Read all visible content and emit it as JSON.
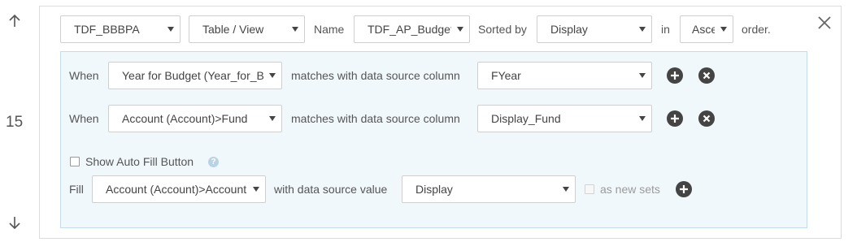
{
  "row": {
    "number": "15"
  },
  "icons": {
    "move_up": "arrow-up-icon",
    "move_down": "arrow-down-icon",
    "close": "close-icon",
    "add": "plus-circle-icon",
    "remove": "x-circle-icon",
    "help": "question-circle-icon"
  },
  "header": {
    "source_select": "TDF_BBBPA",
    "type_select": "Table / View",
    "name_label": "Name",
    "name_select": "TDF_AP_Budget...",
    "sorted_by_label": "Sorted by",
    "sort_field_select": "Display",
    "in_label": "in",
    "order_select": "Ascending",
    "order_label": "order."
  },
  "conditions": [
    {
      "when_label": "When",
      "field_select": "Year for Budget (Year_for_Budget)",
      "matches_label": "matches with data source column",
      "column_select": "FYear"
    },
    {
      "when_label": "When",
      "field_select": "Account (Account)>Fund",
      "matches_label": "matches with data source column",
      "column_select": "Display_Fund"
    }
  ],
  "auto_fill": {
    "label": "Show Auto Fill Button",
    "checked": false
  },
  "fill": {
    "fill_label": "Fill",
    "field_select": "Account (Account)>Account",
    "with_label": "with data source value",
    "value_select": "Display",
    "as_new_sets_label": "as new sets"
  },
  "colors": {
    "panel_bg": "#f1f8fc",
    "panel_border": "#c6dbe8",
    "button_dark": "#444444"
  }
}
